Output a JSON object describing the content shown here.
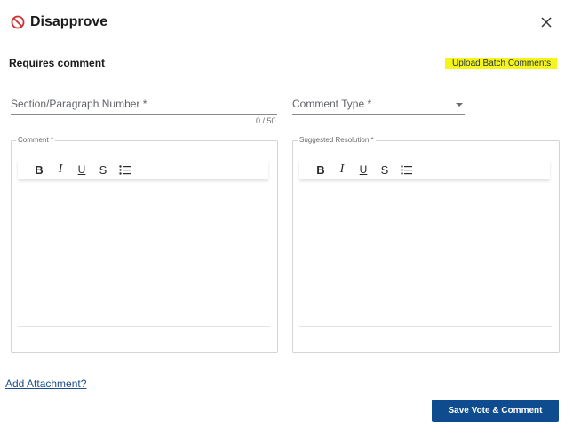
{
  "dialog": {
    "title": "Disapprove",
    "requires_comment": "Requires comment",
    "upload_link": "Upload Batch Comments",
    "colors": {
      "primary": "#0f4c8f",
      "highlight": "#f5f51a",
      "ban_icon": "#d32f2f"
    }
  },
  "fields": {
    "section": {
      "label": "Section/Paragraph Number *",
      "value": "",
      "counter": "0 / 50"
    },
    "comment_type": {
      "label": "Comment Type *",
      "value": ""
    }
  },
  "editors": {
    "comment": {
      "label": "Comment *",
      "content": ""
    },
    "resolution": {
      "label": "Suggested Resolution *",
      "content": ""
    }
  },
  "toolbar_icons": [
    "bold-icon",
    "italic-icon",
    "underline-icon",
    "strikethrough-icon",
    "bullet-list-icon"
  ],
  "footer": {
    "attachment_link": "Add Attachment?",
    "save_button": "Save Vote & Comment"
  }
}
